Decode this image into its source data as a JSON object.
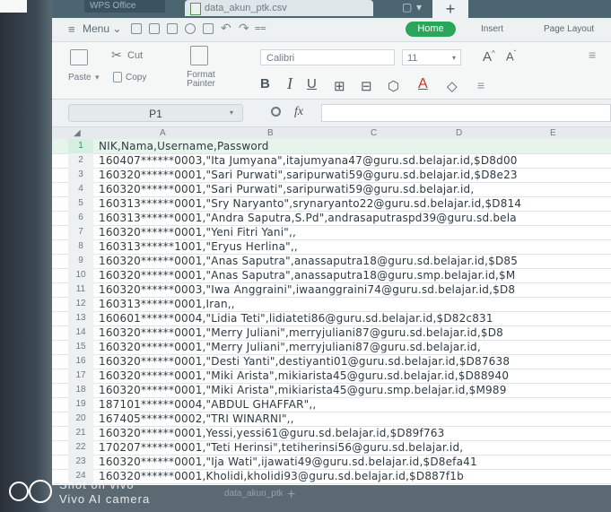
{
  "window": {
    "app_tab": "WPS Office",
    "doc_tab": "data_akun_ptk.csv",
    "menu_label": "Menu",
    "ribbon_tabs": [
      "Home",
      "Insert",
      "Page Layout"
    ]
  },
  "ribbon": {
    "cut": "Cut",
    "paste": "Paste",
    "copy": "Copy",
    "format_painter": "Format Painter",
    "font": "Calibri",
    "size": "11"
  },
  "formula_bar": {
    "cell_ref": "P1",
    "fx": "fx",
    "value": ""
  },
  "columns": [
    "A",
    "B",
    "C",
    "D",
    "E"
  ],
  "rows": [
    {
      "n": "1",
      "text": "NIK,Nama,Username,Password"
    },
    {
      "n": "2",
      "text": "160407******0003,\"Ita Jumyana\",itajumyana47@guru.sd.belajar.id,$D8d00"
    },
    {
      "n": "3",
      "text": "160320******0001,\"Sari Purwati\",saripurwati59@guru.sd.belajar.id,$D8e23"
    },
    {
      "n": "4",
      "text": "160320******0001,\"Sari Purwati\",saripurwati59@guru.sd.belajar.id,"
    },
    {
      "n": "5",
      "text": "160313******0001,\"Sry Naryanto\",srynaryanto22@guru.sd.belajar.id,$D814"
    },
    {
      "n": "6",
      "text": "160313******0001,\"Andra Saputra,S.Pd\",andrasaputraspd39@guru.sd.bela"
    },
    {
      "n": "7",
      "text": "160320******0001,\"Yeni Fitri Yani\",,"
    },
    {
      "n": "8",
      "text": "160313******1001,\"Eryus Herlina\",,"
    },
    {
      "n": "9",
      "text": "160320******0001,\"Anas Saputra\",anassaputra18@guru.sd.belajar.id,$D85"
    },
    {
      "n": "10",
      "text": "160320******0001,\"Anas Saputra\",anassaputra18@guru.smp.belajar.id,$M"
    },
    {
      "n": "11",
      "text": "160320******0003,\"Iwa Anggraini\",iwaanggraini74@guru.sd.belajar.id,$D8"
    },
    {
      "n": "12",
      "text": "160313******0001,Iran,,"
    },
    {
      "n": "13",
      "text": "160601******0004,\"Lidia Teti\",lidiateti86@guru.sd.belajar.id,$D82c831"
    },
    {
      "n": "14",
      "text": "160320******0001,\"Merry Juliani\",merryjuliani87@guru.sd.belajar.id,$D8"
    },
    {
      "n": "15",
      "text": "160320******0001,\"Merry Juliani\",merryjuliani87@guru.sd.belajar.id,"
    },
    {
      "n": "16",
      "text": "160320******0001,\"Desti Yanti\",destiyanti01@guru.sd.belajar.id,$D87638"
    },
    {
      "n": "17",
      "text": "160320******0001,\"Miki Arista\",mikiarista45@guru.sd.belajar.id,$D88940"
    },
    {
      "n": "18",
      "text": "160320******0001,\"Miki Arista\",mikiarista45@guru.smp.belajar.id,$M989"
    },
    {
      "n": "19",
      "text": "187101******0004,\"ABDUL GHAFFAR\",,"
    },
    {
      "n": "20",
      "text": "167405******0002,\"TRI WINARNI\",,"
    },
    {
      "n": "21",
      "text": "160320******0001,Yessi,yessi61@guru.sd.belajar.id,$D89f763"
    },
    {
      "n": "22",
      "text": "170207******0001,\"Teti Herinsi\",tetiherinsi56@guru.sd.belajar.id,"
    },
    {
      "n": "23",
      "text": "160320******0001,\"Ija Wati\",ijawati49@guru.sd.belajar.id,$D8efa41"
    },
    {
      "n": "24",
      "text": "160320******0001,Kholidi,kholidi93@guru.sd.belajar.id,$D887f1b"
    }
  ],
  "sheet_tab": "data_akun_ptk",
  "watermark": {
    "line1": "Shot on vivo",
    "line2": "Vivo AI camera"
  }
}
